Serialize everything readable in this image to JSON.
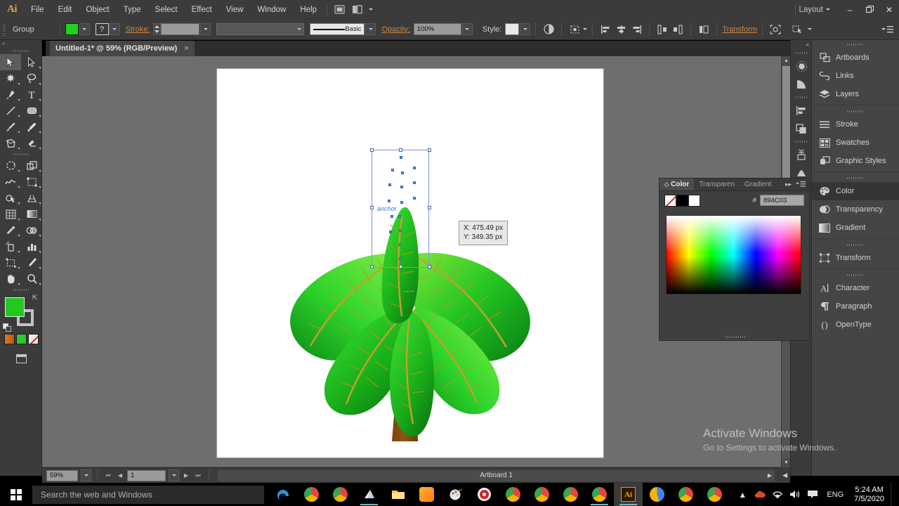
{
  "app": {
    "logo_text": "Ai",
    "layout_label": "Layout",
    "menus": [
      "File",
      "Edit",
      "Object",
      "Type",
      "Select",
      "Effect",
      "View",
      "Window",
      "Help"
    ],
    "window_controls": {
      "minimize": "–",
      "restore": "❐",
      "close": "✕"
    }
  },
  "control_bar": {
    "selection_label": "Group",
    "fill_color": "#1fd11f",
    "question_mark": "?",
    "stroke_label": "Stroke:",
    "stroke_weight": "",
    "brush_label": "Basic",
    "opacity_label": "Opacity:",
    "opacity_value": "100%",
    "style_label": "Style:",
    "transform_label": "Transform",
    "icons": [
      "recolor-artwork-icon",
      "align-options-icon",
      "align-left-icon",
      "align-center-icon",
      "align-right-icon",
      "distribute-top-icon",
      "distribute-bottom-icon",
      "distribute-spacing-icon",
      "isolate-icon",
      "shape-builder-icon",
      "panel-menu-icon"
    ]
  },
  "document": {
    "tab_title": "Untitled-1* @ 59% (RGB/Preview)",
    "close_glyph": "×"
  },
  "canvas": {
    "anchor_label": "anchor",
    "coord_x": "X: 475.49 px",
    "coord_y": "Y: 349.35 px"
  },
  "status_bar": {
    "zoom": "59%",
    "page": "1",
    "artboard_name": "Artboard 1",
    "first_glyph": "⏮",
    "prev_glyph": "◀",
    "next_glyph": "▶",
    "last_glyph": "⏭",
    "right_glyph": "▶",
    "left_glyph": "◀"
  },
  "icon_dock": {
    "collapse_glyph": "«",
    "items": [
      "sun-brightness-icon",
      "shape-wedge-icon",
      "align-panel-icon",
      "pathfinder-icon",
      "symbols-icon",
      "brushes-icon"
    ]
  },
  "panel_list": {
    "groups": [
      {
        "items": [
          {
            "label": "Artboards",
            "icon": "artboards-icon"
          },
          {
            "label": "Links",
            "icon": "links-icon"
          },
          {
            "label": "Layers",
            "icon": "layers-icon"
          }
        ]
      },
      {
        "items": [
          {
            "label": "Stroke",
            "icon": "stroke-icon"
          },
          {
            "label": "Swatches",
            "icon": "swatches-icon"
          },
          {
            "label": "Graphic Styles",
            "icon": "graphic-styles-icon"
          }
        ]
      },
      {
        "items": [
          {
            "label": "Color",
            "icon": "color-icon",
            "selected": true
          },
          {
            "label": "Transparency",
            "icon": "transparency-icon"
          },
          {
            "label": "Gradient",
            "icon": "gradient-icon"
          }
        ]
      },
      {
        "items": [
          {
            "label": "Transform",
            "icon": "transform-icon"
          }
        ]
      },
      {
        "items": [
          {
            "label": "Character",
            "icon": "character-icon"
          },
          {
            "label": "Paragraph",
            "icon": "paragraph-icon"
          },
          {
            "label": "OpenType",
            "icon": "opentype-icon"
          }
        ]
      }
    ]
  },
  "color_panel": {
    "tabs": [
      {
        "label": "Color",
        "active": true
      },
      {
        "label": "Transparen",
        "active": false
      },
      {
        "label": "Gradient",
        "active": false
      }
    ],
    "expand_glyph": "▸▸",
    "menu_glyph": "▾☰",
    "hash_symbol": "#",
    "hex_value": "894C03",
    "swatch_none": "none-swatch",
    "swatch_black": "#000000",
    "swatch_white": "#ffffff"
  },
  "watermark": {
    "title": "Activate Windows",
    "subtitle": "Go to Settings to activate Windows."
  },
  "taskbar": {
    "search_placeholder": "Search the web and Windows",
    "language": "ENG",
    "time": "5:24 AM",
    "date": "7/5/2020",
    "apps": [
      {
        "name": "edge",
        "label": "e"
      },
      {
        "name": "chrome-1",
        "label": ""
      },
      {
        "name": "chrome-2",
        "label": ""
      },
      {
        "name": "file-explorer-teams",
        "label": ""
      },
      {
        "name": "file-explorer",
        "label": ""
      },
      {
        "name": "uc-browser",
        "label": ""
      },
      {
        "name": "paint",
        "label": ""
      },
      {
        "name": "recorder",
        "label": ""
      },
      {
        "name": "chrome-3",
        "label": ""
      },
      {
        "name": "chrome-4",
        "label": ""
      },
      {
        "name": "chrome-5",
        "label": ""
      },
      {
        "name": "chrome-6",
        "label": ""
      },
      {
        "name": "illustrator",
        "label": "Ai"
      },
      {
        "name": "chrome-7",
        "label": ""
      },
      {
        "name": "chrome-8",
        "label": ""
      },
      {
        "name": "chrome-9",
        "label": ""
      }
    ],
    "tray": [
      "show-hidden-icon",
      "onedrive-icon",
      "wifi-icon",
      "volume-icon",
      "action-center-icon"
    ]
  },
  "artwork": {
    "name": "palm-tree-illustration",
    "trunk_color": "#8b4f10",
    "leaf_colors": [
      "#19b519",
      "#2ee02e",
      "#0b8a18",
      "#57e03a"
    ],
    "vein_color": "#c9a227"
  }
}
